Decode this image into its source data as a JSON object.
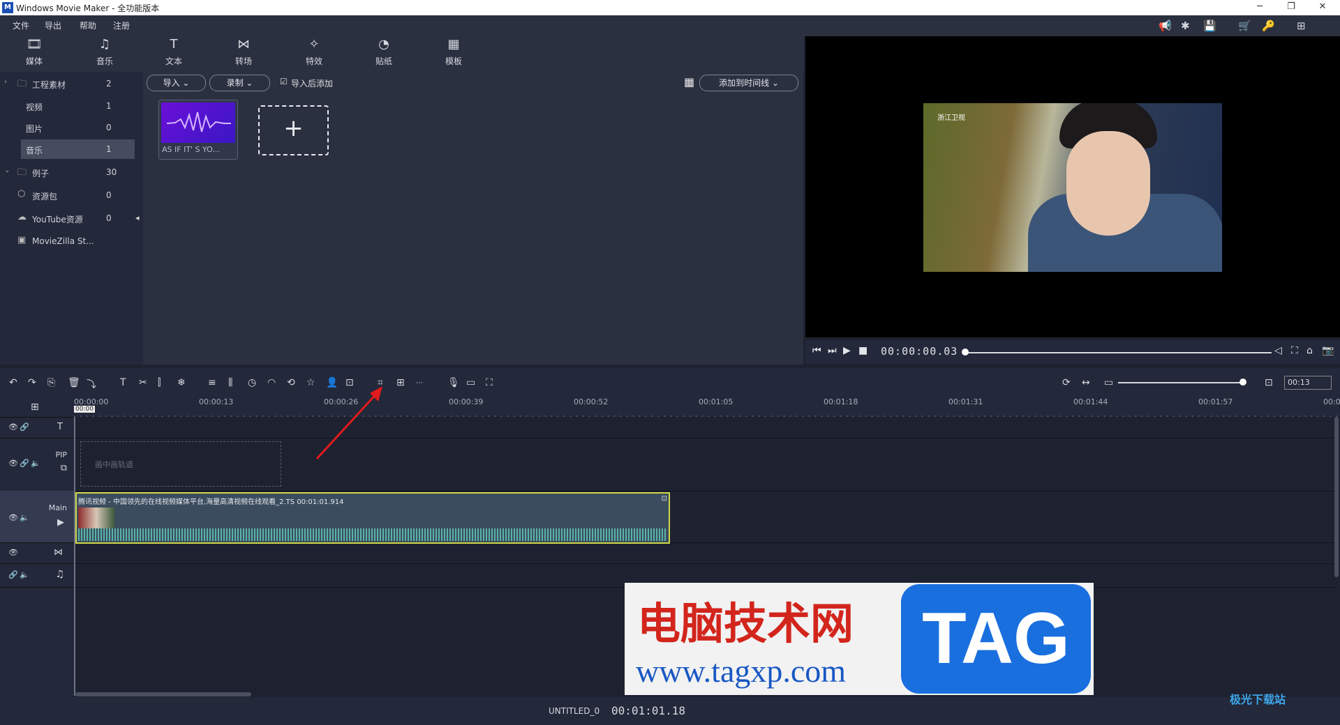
{
  "app": {
    "title": "Windows Movie Maker  - 全功能版本",
    "logo": "M"
  },
  "window_controls": [
    "─",
    "❐",
    "✕"
  ],
  "menu": [
    "文件",
    "导出",
    "帮助",
    "注册"
  ],
  "top_icons": [
    "megaphone-icon",
    "star-icon",
    "save-icon",
    "cart-icon",
    "key-icon",
    "grid-icon"
  ],
  "tabs": [
    {
      "label": "媒体",
      "icon": "media-icon",
      "glyph": "🎞"
    },
    {
      "label": "音乐",
      "icon": "music-icon",
      "glyph": "♫"
    },
    {
      "label": "文本",
      "icon": "text-icon",
      "glyph": "T"
    },
    {
      "label": "转场",
      "icon": "transition-icon",
      "glyph": "⋈"
    },
    {
      "label": "特效",
      "icon": "effects-icon",
      "glyph": "✧"
    },
    {
      "label": "贴纸",
      "icon": "sticker-icon",
      "glyph": "◔"
    },
    {
      "label": "模板",
      "icon": "template-icon",
      "glyph": "▦"
    }
  ],
  "sidebar": {
    "items": [
      {
        "label": "工程素材",
        "count": "2",
        "icon": "folder-icon",
        "glyph": "🗀",
        "arrow": "›"
      },
      {
        "label": "视频",
        "count": "1"
      },
      {
        "label": "图片",
        "count": "0"
      },
      {
        "label": "音乐",
        "count": "1",
        "selected": true
      },
      {
        "label": "例子",
        "count": "30",
        "icon": "folder-icon",
        "glyph": "🗀",
        "arrow": "⌄"
      },
      {
        "label": "资源包",
        "count": "0",
        "icon": "package-icon",
        "glyph": "⬡"
      },
      {
        "label": "YouTube资源",
        "count": "0",
        "icon": "cloud-icon",
        "glyph": "☁"
      },
      {
        "label": "MovieZilla St...",
        "count": "",
        "icon": "store-icon",
        "glyph": "▣"
      }
    ],
    "collapse": "◂"
  },
  "media_toolbar": {
    "import": "导入  ⌄",
    "record": "录制  ⌄",
    "checkbox_label": "导入后添加",
    "checked": "☑",
    "add_to_timeline": "添加到时间线  ⌄",
    "view_glyph": "▦"
  },
  "media_items": [
    {
      "name": "AS IF IT' S YO..."
    }
  ],
  "add_glyph": "+",
  "preview": {
    "channel_logo": "浙江卫视",
    "timecode": "00:00:00.03",
    "volume_icon": "◁",
    "controls": [
      "⏮",
      "⏭",
      "▶",
      "■"
    ],
    "right_icons": [
      "⛶",
      "⌂",
      "📷"
    ]
  },
  "timeline_toolbar": {
    "icons": [
      "↶",
      "↷",
      "⎘",
      "🗑",
      "⤵",
      "T",
      "✂",
      "⫿",
      "❄",
      "≡",
      "⫼",
      "◷",
      "◠",
      "⟲",
      "☆",
      "👤",
      "⊡",
      "⌗",
      "⊞",
      "⋯",
      "🎙",
      "▭",
      "⛶"
    ],
    "right_icons": [
      "⟳",
      "↔",
      "▭",
      "⊡"
    ],
    "zoom_value": "00:13"
  },
  "ruler": [
    "00:00:00",
    "00:00:13",
    "00:00:26",
    "00:00:39",
    "00:00:52",
    "00:01:05",
    "00:01:18",
    "00:01:31",
    "00:01:44",
    "00:01:57",
    "00:0"
  ],
  "playhead_label": "00:00",
  "tracks": {
    "text_track": {
      "glyph": "T"
    },
    "pip": {
      "label": "PIP",
      "placeholder": "画中画轨道"
    },
    "main": {
      "label": "Main"
    },
    "transition": {
      "glyph": "⋈"
    },
    "music": {
      "glyph": "♫"
    }
  },
  "clip": {
    "title": "腾讯视频 - 中国领先的在线视频媒体平台,海量高清视频在线观看_2.TS   00:01:01.914"
  },
  "status": {
    "project": "UNTITLED_0",
    "timecode": "00:01:01.18"
  },
  "watermark": {
    "cn": "电脑技术网",
    "url": "www.tagxp.com",
    "tag": "TAG",
    "corner": "极光下载站"
  }
}
